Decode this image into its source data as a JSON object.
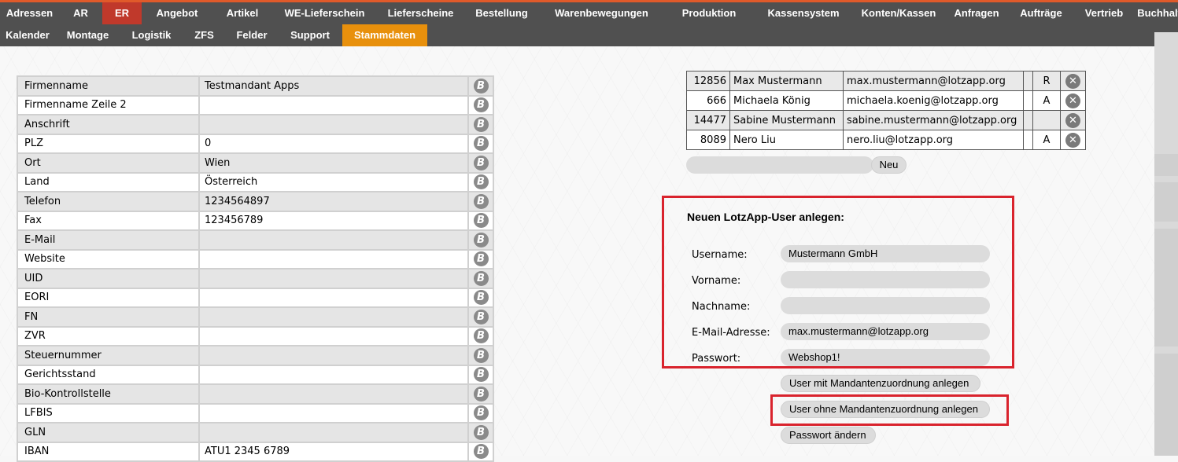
{
  "nav": {
    "row1": [
      "Adressen",
      "AR",
      "ER",
      "Angebot",
      "Artikel",
      "WE-Lieferschein",
      "Lieferscheine",
      "Bestellung",
      "Warenbewegungen",
      "Produktion",
      "Kassensystem",
      "Konten/Kassen",
      "Anfragen",
      "Aufträge",
      "Vertrieb",
      "Buchhaltung"
    ],
    "row2": [
      "Kalender",
      "Montage",
      "Logistik",
      "ZFS",
      "Felder",
      "Support",
      "Stammdaten"
    ],
    "active_row1": "ER",
    "active_row2": "Stammdaten"
  },
  "colors": {
    "accent_red": "#c0392b",
    "accent_orange": "#e8900c",
    "nav_bg": "#505050",
    "highlight": "#d9232d"
  },
  "stammdaten": {
    "rows": [
      {
        "label": "Firmenname",
        "value": "Testmandant Apps"
      },
      {
        "label": "Firmenname Zeile 2",
        "value": ""
      },
      {
        "label": "Anschrift",
        "value": ""
      },
      {
        "label": "PLZ",
        "value": "0"
      },
      {
        "label": "Ort",
        "value": "Wien"
      },
      {
        "label": "Land",
        "value": "Österreich"
      },
      {
        "label": "Telefon",
        "value": "1234564897"
      },
      {
        "label": "Fax",
        "value": "123456789"
      },
      {
        "label": "E-Mail",
        "value": ""
      },
      {
        "label": "Website",
        "value": ""
      },
      {
        "label": "UID",
        "value": ""
      },
      {
        "label": "EORI",
        "value": ""
      },
      {
        "label": "FN",
        "value": ""
      },
      {
        "label": "ZVR",
        "value": ""
      },
      {
        "label": "Steuernummer",
        "value": ""
      },
      {
        "label": "Gerichtsstand",
        "value": ""
      },
      {
        "label": "Bio-Kontrollstelle",
        "value": ""
      },
      {
        "label": "LFBIS",
        "value": ""
      },
      {
        "label": "GLN",
        "value": ""
      },
      {
        "label": "IBAN",
        "value": "ATU1 2345 6789"
      }
    ],
    "edit_icon_glyph": "B",
    "edit_icon_name": "b-edit-icon"
  },
  "users": {
    "rows": [
      {
        "id": "12856",
        "name": "Max Mustermann",
        "email": "max.mustermann@lotzapp.org",
        "flag": "R"
      },
      {
        "id": "666",
        "name": "Michaela König",
        "email": "michaela.koenig@lotzapp.org",
        "flag": "A"
      },
      {
        "id": "14477",
        "name": "Sabine Mustermann",
        "email": "sabine.mustermann@lotzapp.org",
        "flag": ""
      },
      {
        "id": "8089",
        "name": "Nero Liu",
        "email": "nero.liu@lotzapp.org",
        "flag": "A"
      }
    ],
    "delete_glyph": "✕",
    "new_input_value": "",
    "new_button": "Neu"
  },
  "new_user_form": {
    "title": "Neuen LotzApp-User anlegen:",
    "fields": [
      {
        "label": "Username:",
        "value": "Mustermann GmbH"
      },
      {
        "label": "Vorname:",
        "value": ""
      },
      {
        "label": "Nachname:",
        "value": ""
      },
      {
        "label": "E-Mail-Adresse:",
        "value": "max.mustermann@lotzapp.org"
      },
      {
        "label": "Passwort:",
        "value": "Webshop1!"
      }
    ],
    "btn_with_mandant": "User mit Mandantenzuordnung anlegen",
    "btn_without_mandant": "User ohne Mandantenzuordnung anlegen",
    "btn_change_password": "Passwort ändern"
  }
}
